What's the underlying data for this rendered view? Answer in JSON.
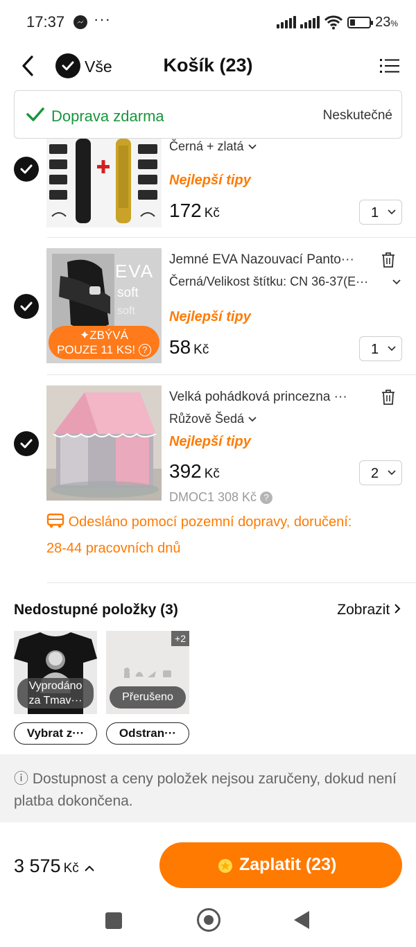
{
  "status_bar": {
    "time": "17:37",
    "more": "···",
    "battery_percent": "23",
    "battery_unit": "%",
    "icons": [
      "messenger-icon",
      "signal-icon",
      "wifi-icon",
      "battery-icon"
    ]
  },
  "header": {
    "select_all_label": "Vše",
    "title": "Košík (23)"
  },
  "shipping": {
    "label": "Doprava zdarma",
    "status": "Neskutečné"
  },
  "items": [
    {
      "variant": "Černá + zlatá",
      "tag": "Nejlepší tipy",
      "price": "172",
      "currency": "Kč",
      "quantity": "1"
    },
    {
      "name": "Jemné EVA Nazouvací Panto···",
      "variant": "Černá/Velikost štítku: CN 36-37(E···",
      "tag": "Nejlepší tipy",
      "price": "58",
      "currency": "Kč",
      "quantity": "1",
      "stock_line1": "ZBÝVÁ",
      "stock_line2": "POUZE 11 KS!",
      "image_text_1": "EVA",
      "image_text_2": "soft",
      "image_text_3": "soft"
    },
    {
      "name": "Velká pohádková princezna ···",
      "variant": "Růžově Šedá",
      "tag": "Nejlepší tipy",
      "price": "392",
      "currency": "Kč",
      "quantity": "2",
      "original_price": "DMOC1 308 Kč"
    }
  ],
  "delivery": {
    "text_line1": "Odesláno pomocí pozemní dopravy, doručení:",
    "text_line2": "28-44 pracovních dnů"
  },
  "unavailable": {
    "title": "Nedostupné položky (3)",
    "show_label": "Zobrazit",
    "items": [
      {
        "label_line1": "Vyprodáno",
        "label_line2": "za Tmav···",
        "button": "Vybrat z···"
      },
      {
        "label_line1": "Přerušeno",
        "extra_badge": "+2",
        "button": "Odstran···"
      }
    ]
  },
  "notice": {
    "text": "ⓘ Dostupnost a ceny položek nejsou zaručeny, dokud není platba dokončena."
  },
  "footer": {
    "total": "3 575",
    "currency": "Kč",
    "pay_label": "Zaplatit (23)"
  },
  "colors": {
    "accent_orange": "#ff7a00",
    "shipping_green": "#17963d",
    "checkbox_black": "#111111"
  }
}
